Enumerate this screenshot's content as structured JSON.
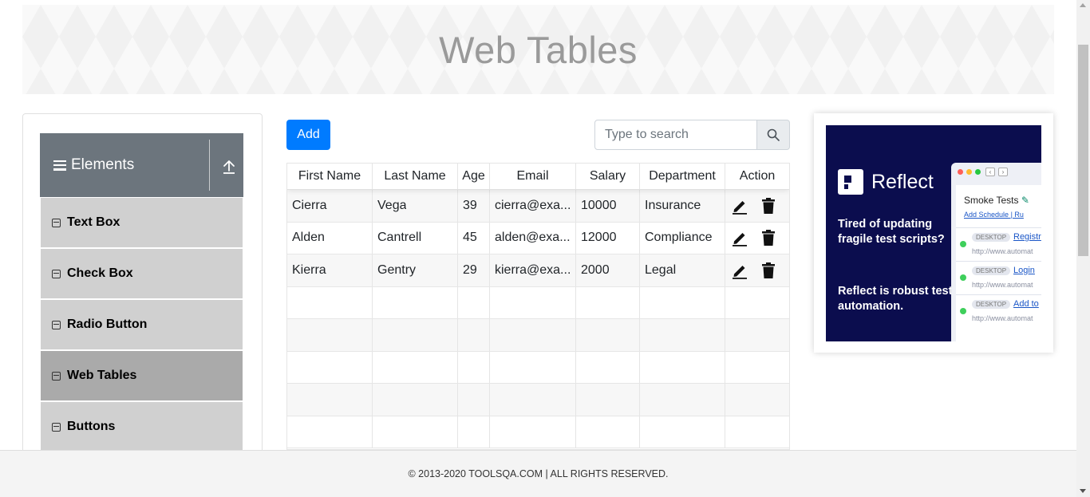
{
  "header": {
    "title": "Web Tables"
  },
  "sidebar": {
    "group_title": "Elements",
    "items": [
      {
        "label": "Text Box",
        "active": false
      },
      {
        "label": "Check Box",
        "active": false
      },
      {
        "label": "Radio Button",
        "active": false
      },
      {
        "label": "Web Tables",
        "active": true
      },
      {
        "label": "Buttons",
        "active": false
      }
    ]
  },
  "toolbar": {
    "add_label": "Add",
    "search_placeholder": "Type to search",
    "search_value": ""
  },
  "table": {
    "headers": [
      "First Name",
      "Last Name",
      "Age",
      "Email",
      "Salary",
      "Department",
      "Action"
    ],
    "rows": [
      {
        "first_name": "Cierra",
        "last_name": "Vega",
        "age": "39",
        "email": "cierra@exa...",
        "salary": "10000",
        "department": "Insurance"
      },
      {
        "first_name": "Alden",
        "last_name": "Cantrell",
        "age": "45",
        "email": "alden@exa...",
        "salary": "12000",
        "department": "Compliance"
      },
      {
        "first_name": "Kierra",
        "last_name": "Gentry",
        "age": "29",
        "email": "kierra@exa...",
        "salary": "2000",
        "department": "Legal"
      }
    ],
    "row_icons": [
      "pencil-icon",
      "trash-icon"
    ]
  },
  "ad": {
    "brand": "Reflect",
    "copy1": "Tired of updating fragile test scripts?",
    "copy2": "Reflect is robust test automation.",
    "panel_title": "Smoke Tests",
    "schedule_link": "Add Schedule",
    "schedule_extra": "| Ru",
    "tests": [
      {
        "tag": "DESKTOP",
        "name": "Registr",
        "url": "http://www.automat"
      },
      {
        "tag": "DESKTOP",
        "name": "Login",
        "url": "http://www.automat"
      },
      {
        "tag": "DESKTOP",
        "name": "Add to",
        "url": "http://www.automat"
      }
    ]
  },
  "footer": {
    "text": "© 2013-2020 TOOLSQA.COM | ALL RIGHTS RESERVED."
  },
  "colors": {
    "primary": "#007bff",
    "sidebar_header": "#6c757d",
    "sidebar_item": "#d0d0d0",
    "sidebar_active": "#aaaaaa",
    "ad_bg": "#0b0d4e"
  }
}
